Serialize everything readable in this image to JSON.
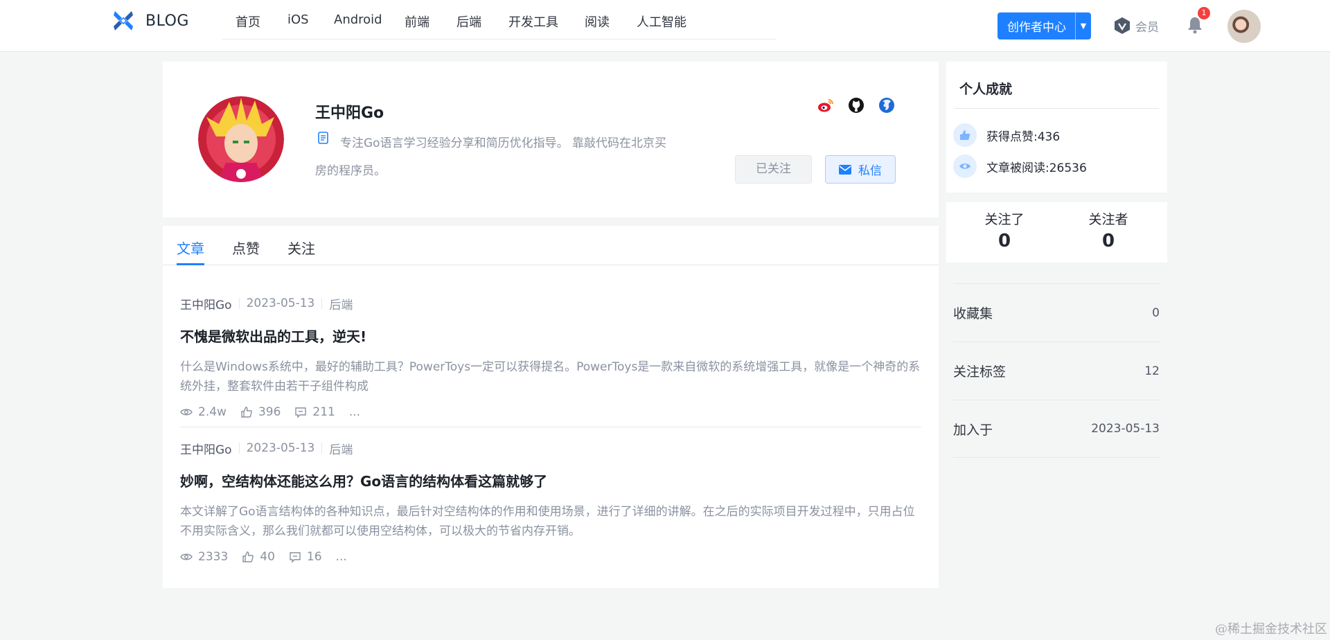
{
  "header": {
    "logo_text": "BLOG",
    "nav": [
      {
        "label": "首页"
      },
      {
        "label": "iOS"
      },
      {
        "label": "Android"
      },
      {
        "label": "前端"
      },
      {
        "label": "后端"
      },
      {
        "label": "开发工具"
      },
      {
        "label": "阅读"
      },
      {
        "label": "人工智能"
      }
    ],
    "creator_button": "创作者中心",
    "vip_label": "会员",
    "notification_count": "1"
  },
  "profile": {
    "name": "王中阳Go",
    "bio": "专注Go语言学习经验分享和简历优化指导。 靠敲代码在北京买房的程序员。",
    "followed_label": "已关注",
    "message_label": "私信",
    "social_icons": [
      "weibo-icon",
      "github-icon",
      "website-icon"
    ]
  },
  "tabs": [
    {
      "label": "文章",
      "active": true
    },
    {
      "label": "点赞",
      "active": false
    },
    {
      "label": "关注",
      "active": false
    }
  ],
  "articles": [
    {
      "author": "王中阳Go",
      "date": "2023-05-13",
      "category": "后端",
      "title": "不愧是微软出品的工具，逆天!",
      "abstract": "什么是Windows系统中，最好的辅助工具？PowerToys一定可以获得提名。PowerToys是一款来自微软的系统增强工具，就像是一个神奇的系统外挂，整套软件由若干子组件构成",
      "views": "2.4w",
      "likes": "396",
      "comments": "211",
      "more": "..."
    },
    {
      "author": "王中阳Go",
      "date": "2023-05-13",
      "category": "后端",
      "title": "妙啊，空结构体还能这么用？Go语言的结构体看这篇就够了",
      "abstract": "本文详解了Go语言结构体的各种知识点，最后针对空结构体的作用和使用场景，进行了详细的讲解。在之后的实际项目开发过程中，只用占位不用实际含义，那么我们就都可以使用空结构体，可以极大的节省内存开销。",
      "views": "2333",
      "likes": "40",
      "comments": "16",
      "more": "..."
    }
  ],
  "achievements": {
    "title": "个人成就",
    "likes": "获得点赞:436",
    "reads": "文章被阅读:26536"
  },
  "follow": {
    "following_label": "关注了",
    "following_count": "0",
    "followers_label": "关注者",
    "followers_count": "0"
  },
  "side_list": [
    {
      "label": "收藏集",
      "value": "0"
    },
    {
      "label": "关注标签",
      "value": "12"
    },
    {
      "label": "加入于",
      "value": "2023-05-13"
    }
  ],
  "watermark": "@稀土掘金技术社区",
  "colors": {
    "accent": "#1e80ff",
    "background": "#f4f5f5",
    "text": "#252933",
    "muted": "#8a919f"
  }
}
